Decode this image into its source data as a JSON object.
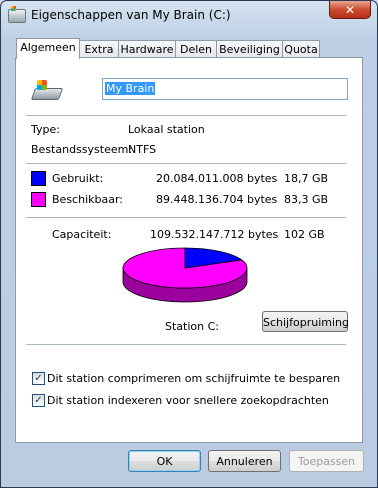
{
  "window": {
    "title": "Eigenschappen van My Brain (C:)",
    "close_glyph": "✕"
  },
  "tabs": [
    "Algemeen",
    "Extra",
    "Hardware",
    "Delen",
    "Beveiliging",
    "Quota"
  ],
  "active_tab": "Algemeen",
  "general": {
    "drive_name": "My Brain",
    "type_label": "Type:",
    "type_value": "Lokaal station",
    "fs_label": "Bestandssysteem:",
    "fs_value": "NTFS",
    "used": {
      "label": "Gebruikt:",
      "bytes": "20.084.011.008 bytes",
      "size": "18,7 GB",
      "color": "#0000ff",
      "fraction": 0.1834
    },
    "free": {
      "label": "Beschikbaar:",
      "bytes": "89.448.136.704 bytes",
      "size": "83,3 GB",
      "color": "#ff00ff",
      "fraction": 0.8166
    },
    "capacity": {
      "label": "Capaciteit:",
      "bytes": "109.532.147.712 bytes",
      "size": "102 GB"
    },
    "station_label": "Station C:",
    "cleanup_button": "Schijfopruiming",
    "compress_label": "Dit station comprimeren om schijfruimte te besparen",
    "compress_checked": true,
    "index_label": "Dit station indexeren voor snellere zoekopdrachten",
    "index_checked": true
  },
  "buttons": {
    "ok": "OK",
    "cancel": "Annuleren",
    "apply": "Toepassen"
  },
  "icons": {
    "title": "drive-icon",
    "close": "close-icon",
    "check": "checkmark-icon"
  }
}
